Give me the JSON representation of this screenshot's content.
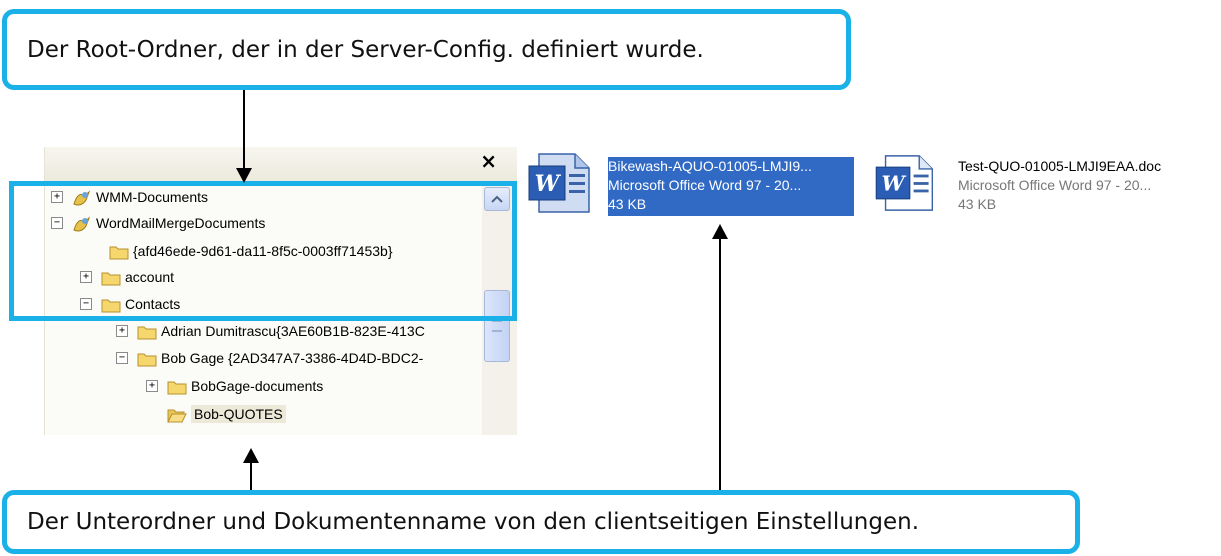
{
  "callouts": {
    "top": "Der Root-Ordner, der in der Server-Config. definiert wurde.",
    "bottom": "Der Unterordner und Dokumentenname von den clientseitigen Einstellungen."
  },
  "tree": {
    "close_label": "×",
    "rows": [
      {
        "label": "WMM-Documents",
        "expander": "+",
        "icon": "special-folder-icon"
      },
      {
        "label": "WordMailMergeDocuments",
        "expander": "−",
        "icon": "special-folder-icon"
      },
      {
        "label": "{afd46ede-9d61-da11-8f5c-0003ff71453b}",
        "expander": "",
        "icon": "folder-icon"
      },
      {
        "label": "account",
        "expander": "+",
        "icon": "folder-icon"
      },
      {
        "label": "Contacts",
        "expander": "−",
        "icon": "folder-icon"
      },
      {
        "label": "Adrian Dumitrascu{3AE60B1B-823E-413C",
        "expander": "+",
        "icon": "folder-icon"
      },
      {
        "label": "Bob Gage {2AD347A7-3386-4D4D-BDC2-",
        "expander": "−",
        "icon": "folder-icon"
      },
      {
        "label": "BobGage-documents",
        "expander": "+",
        "icon": "folder-icon"
      },
      {
        "label": "Bob-QUOTES",
        "expander": "",
        "icon": "open-folder-icon"
      }
    ]
  },
  "files": [
    {
      "name": "Bikewash-AQUO-01005-LMJI9...",
      "type": "Microsoft Office Word 97 - 20...",
      "size": "43 KB",
      "selected": true
    },
    {
      "name": "Test-QUO-01005-LMJI9EAA.doc",
      "type": "Microsoft Office Word 97 - 20...",
      "size": "43 KB",
      "selected": false
    }
  ],
  "colors": {
    "callout_border": "#1ab0e8",
    "selection": "#316ac5",
    "folder": "#f5d76e"
  }
}
